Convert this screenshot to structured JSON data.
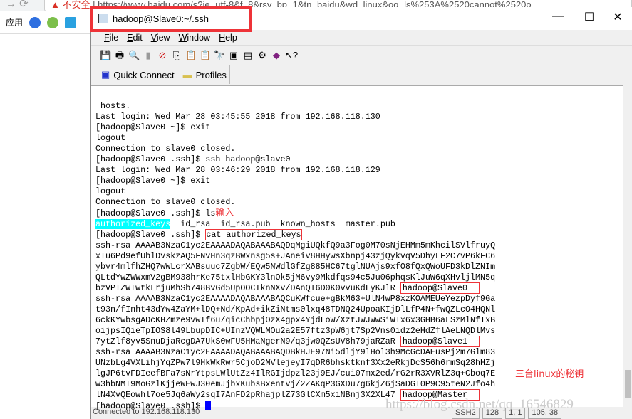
{
  "browser": {
    "security_label": "不安全",
    "url": "https://www.baidu.com/s?ie=utf-8&f=8&rsv_bp=1&tn=baidu&wd=linux&oq=ls%253A%2520cannot%2520o",
    "bookmarks_label": "应用"
  },
  "window": {
    "title": "hadoop@Slave0:~/.ssh"
  },
  "menu": [
    "File",
    "Edit",
    "View",
    "Window",
    "Help"
  ],
  "quickbar": {
    "quick_connect": "Quick Connect",
    "profiles": "Profiles"
  },
  "terminal": {
    "lines": [
      " hosts.",
      "Last login: Wed Mar 28 03:45:55 2018 from 192.168.118.130",
      "[hadoop@Slave0 ~]$ exit",
      "logout",
      "Connection to slave0 closed.",
      "[hadoop@Slave0 .ssh]$ ssh hadoop@slave0",
      "Last login: Wed Mar 28 03:46:29 2018 from 192.168.118.129",
      "[hadoop@Slave0 ~]$ exit",
      "logout",
      "Connection to slave0 closed."
    ],
    "ls_prompt": "[hadoop@Slave0 .ssh]$ ls",
    "ls_note": "输入",
    "ls_files": [
      "authorized_keys",
      "id_rsa",
      "id_rsa.pub",
      "known_hosts",
      "master.pub"
    ],
    "cat_prompt": "[hadoop@Slave0 .ssh]$ ",
    "cat_cmd": "cat authorized_keys",
    "keys": [
      {
        "lines": [
          "ssh-rsa AAAAB3NzaC1yc2EAAAADAQABAAABAQDqMgiUQkfQ9a3Fog0M70sNjEHMm5mKhcilSVlfruyQ",
          "xTu6Pd9efUblDvskzAQ5FNvHn3qzBWxnsg5s+JAneiv8HHywsXbnpj43zjQykvqV5DhyLF2C7vP6kFC6",
          "ybvr4mlfhZHQ7wWLcrXABsuuc7ZgbW/EQw5NWdlGfZg885HC67tglNUAjs9xfO8fQxQWoUFD3kDlZNIm",
          "QLtdYwZWWxmV2gBM938hrKe75txlHbGKY3lnOk5jM6vy9Mkdfqs94c5Ju06phqsKlJuW6qXHvljlMN5q"
        ],
        "last": "bzVPTZWTwtkLrjuMhSb748BvGd5UpOOCTknNXv/DAnQT6D0K0vvuKdLyKJlR",
        "host": "hadoop@Slave0"
      },
      {
        "lines": [
          "ssh-rsa AAAAB3NzaC1yc2EAAAADAQABAAABAQCuKWfcue+gBkM63+UlN4wP8xzKOAMEUeYezpDyf9Ga",
          "t93n/fInht43dYw4ZaYM+lDQ+Nd/KpAd+ikZiNtms0lxq48TDNQ24UpoaKIjDlLfP4N+fwQZLcO4HQNl",
          "6ckKYwbsgADcKHZmze9vwIf6u/qicChbpjOzX4gpx4YjdLoW/XztJWJWwSiWTx6x3GHB6aLSzMlNfIxB",
          "oijpsIQieTpIOS8l49LbupDIC+UInzVQWLMOu2a2E57ftz3pW6jt7Sp2Vns0idz2eHdZflAeLNQDlMvs"
        ],
        "last": "7ytZlf8yv5SnuDjaRcgDA7UkS0wFU5HMaNgerN9/q3jw0QZsUV8h79jaRZaR",
        "host": "hadoop@Slave1"
      },
      {
        "lines": [
          "ssh-rsa AAAAB3NzaC1yc2EAAAADAQABAAABAQDBkHJE97Ni5dljY9lHol3h9McGcDAEusPj2m7Glm83",
          "UNzbLg4VXLihjYqZPw7l9HkWkRwr5CjoD2MVlejeyI7qDR6bhsktknf3Xx2eRkjDcS56h6rmSq28hHZj",
          "lgJP6tvFDIeefBFa7sNrYtpsLWlUtZz4IlRGIjdpzl23j9EJ/cui07mx2ed/rG2rR3XVRlZ3q+Cboq7E",
          "w3hbNMT9MoGzlKjjeWEwJ30emJjbxKubsBxentvj/2ZAKqP3GXDu7g6kjZ6jSaDGT0P9C95teN2Jfo4h"
        ],
        "last": "lN4XvQEowhl7oe5Jq6aWy2sqI7AnFD2pRhajplZ73GlCXm5xiNBnj3X2XL47",
        "host": "hadoop@Master"
      }
    ],
    "final_prompt": "[hadoop@Slave0 .ssh]$ ",
    "annotation": "三台linux的秘钥"
  },
  "watermark": "https://blog.csdn.net/qq_16546829",
  "status": {
    "connection": "Connected to 192.168.118.130",
    "protocol": "SSH2",
    "cipher": "128",
    "position": "1, 1",
    "size": "105, 38"
  },
  "colors": {
    "highlight": "#00ffff",
    "annotation_red": "#ee3338",
    "cursor": "#0000ff"
  }
}
